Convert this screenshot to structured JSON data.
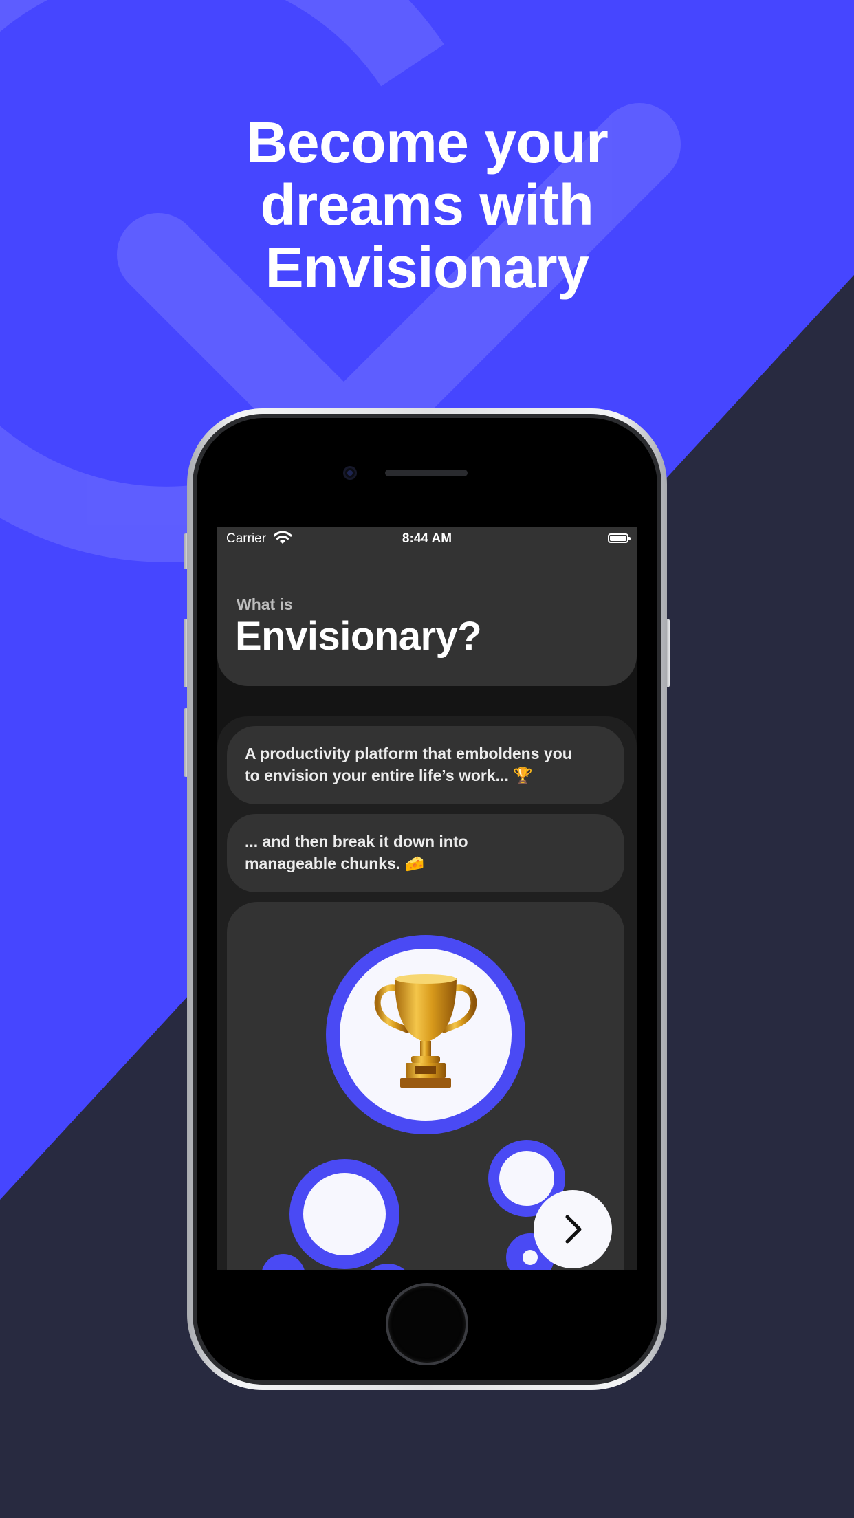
{
  "headline": {
    "line1": "Become your",
    "line2": "dreams with",
    "line3": "Envisionary"
  },
  "status_bar": {
    "carrier": "Carrier",
    "time": "8:44 AM"
  },
  "header": {
    "subtitle": "What is",
    "title": "Envisionary?"
  },
  "bubbles": [
    {
      "line1": "A productivity platform that emboldens you",
      "line2": "to envision your entire life’s work...",
      "emoji": "🏆"
    },
    {
      "line1": "... and then break it down into",
      "line2": "manageable chunks.",
      "emoji": "🧀"
    }
  ],
  "colors": {
    "accent": "#4a4af4",
    "background_top": "#4646ff",
    "background_bottom": "#282a40",
    "card": "#333333"
  },
  "icons": {
    "next": "chevron-right-icon",
    "wifi": "wifi-icon",
    "battery": "battery-icon",
    "trophy": "trophy-icon"
  }
}
